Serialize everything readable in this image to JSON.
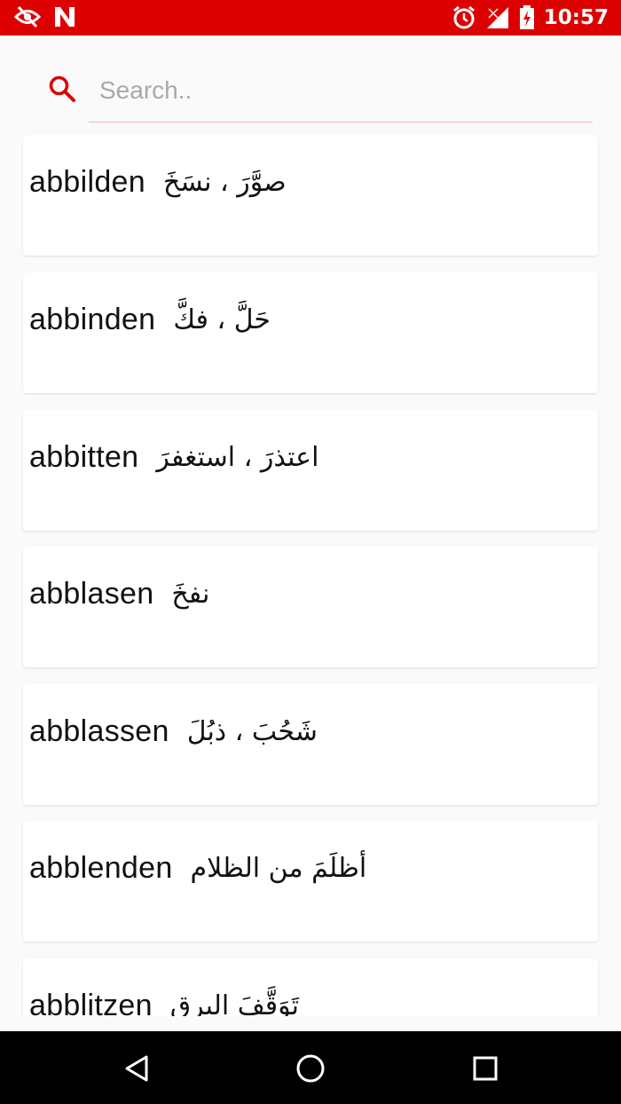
{
  "status_bar": {
    "time": "10:57",
    "icons_left": [
      "eye-off-icon",
      "n-badge-icon"
    ],
    "icons_right": [
      "alarm-icon",
      "signal-off-icon",
      "battery-charging-icon"
    ],
    "color": "#dd0000"
  },
  "search": {
    "placeholder": "Search..",
    "value": "",
    "icon": "search-icon",
    "accent_color": "#dd0000"
  },
  "entries": [
    {
      "german": "abbilden",
      "arabic": "صوَّرَ ، نسَخَ"
    },
    {
      "german": "abbinden",
      "arabic": "حَلَّ ، فكَّ"
    },
    {
      "german": "abbitten",
      "arabic": "اعتذرَ ، استغفرَ"
    },
    {
      "german": "abblasen",
      "arabic": "نفخَ"
    },
    {
      "german": "abblassen",
      "arabic": "شَحُبَ ، ذبُلَ"
    },
    {
      "german": "abblenden",
      "arabic": "أظلَمَ من الظلام"
    },
    {
      "german": "abblitzen",
      "arabic": "تَوَقَّفَ البرق"
    }
  ],
  "nav_bar": {
    "back": "back-triangle-icon",
    "home": "home-circle-icon",
    "recents": "recents-square-icon"
  }
}
